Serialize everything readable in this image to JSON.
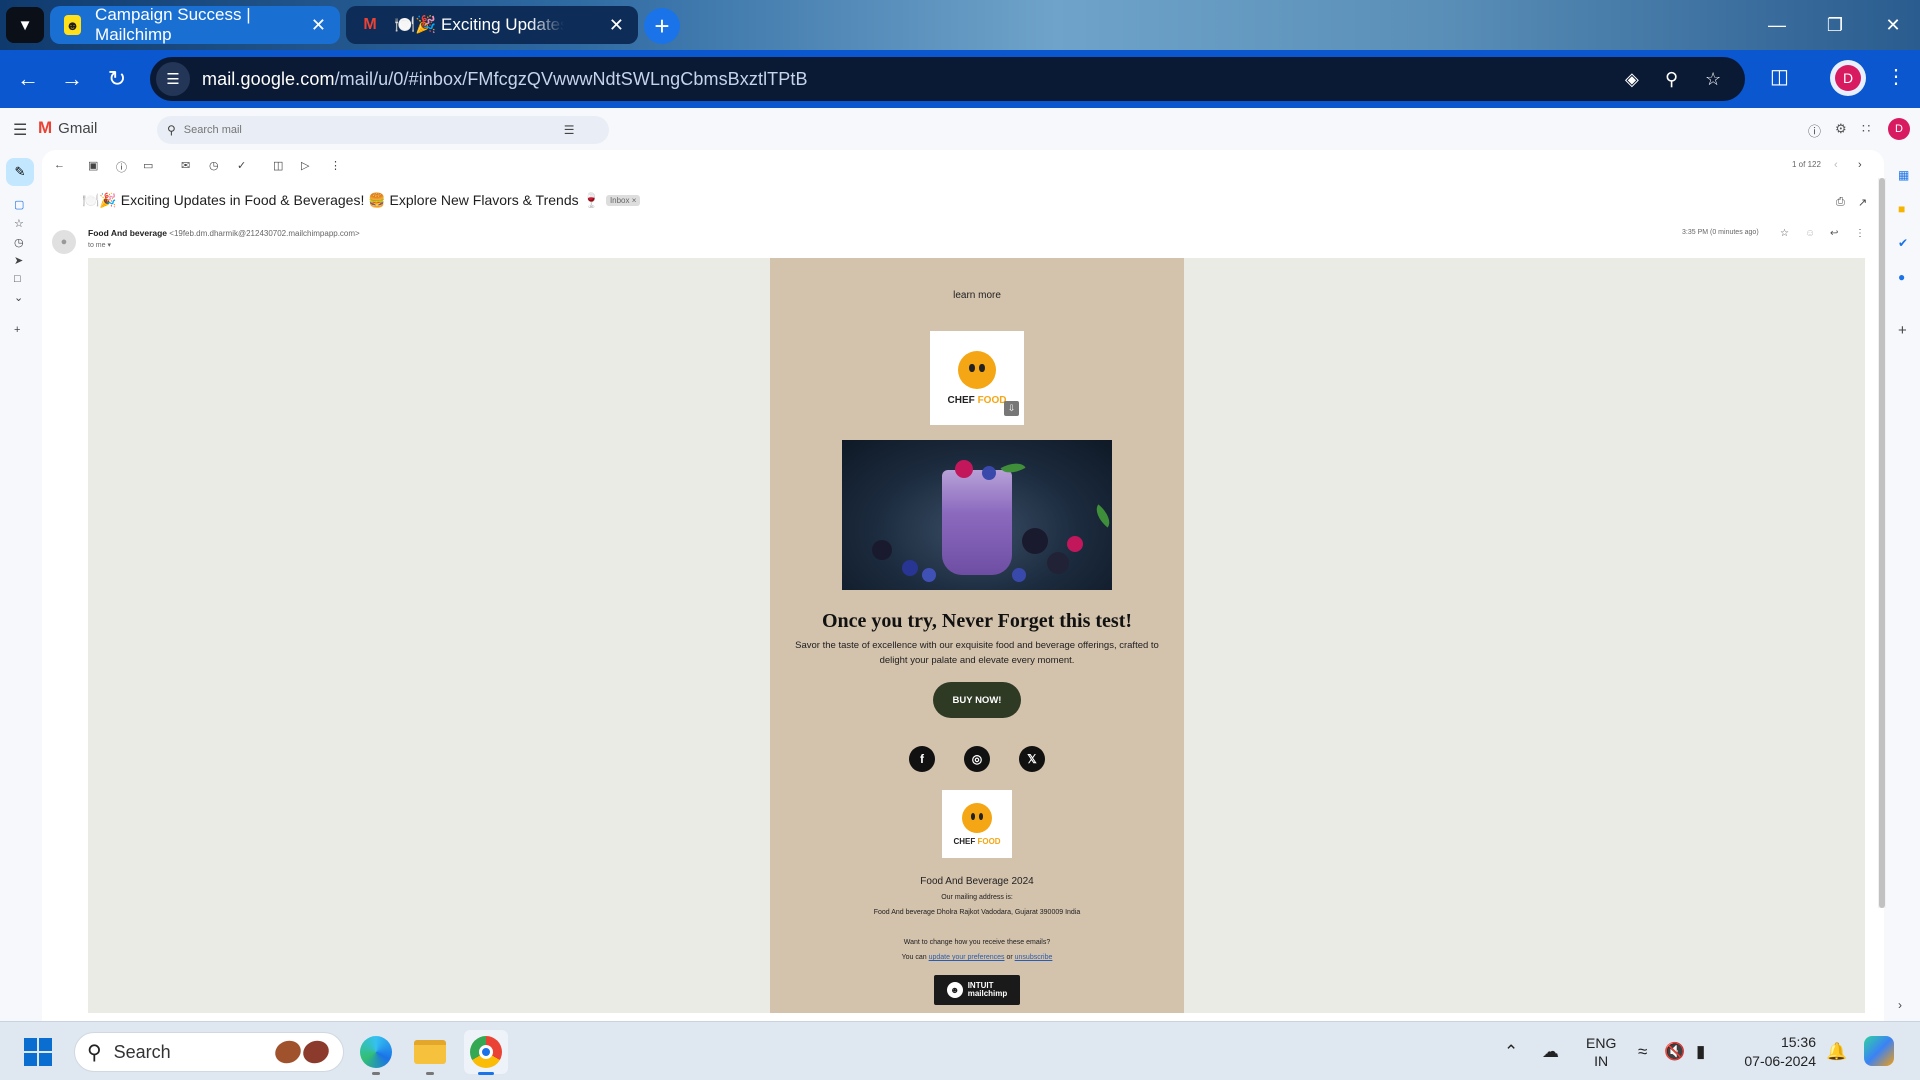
{
  "browser": {
    "tabs": [
      {
        "title": "Campaign Success | Mailchimp",
        "icon": "mailchimp-icon"
      },
      {
        "title": "🍽️🎉 Exciting Updates in Food",
        "icon": "gmail-icon"
      }
    ],
    "url_host": "mail.google.com",
    "url_path": "/mail/u/0/#inbox/FMfcgzQVwwwNdtSWLngCbmsBxztlTPtB",
    "profile_initial": "D",
    "accent": "#0b57d0"
  },
  "gmail": {
    "brand": "Gmail",
    "search_placeholder": "Search mail",
    "avatar_initial": "D",
    "pager": "1 of 122",
    "subject": "🍽️🎉 Exciting Updates in Food & Beverages! 🍔 Explore New Flavors & Trends 🍷",
    "label_chip": "Inbox ×",
    "sender_name": "Food And beverage",
    "sender_addr": "<19feb.dm.dharmik@212430702.mailchimpapp.com>",
    "to_me": "to me ▾",
    "time": "3:35 PM (0 minutes ago)"
  },
  "email": {
    "learn_more": "learn more",
    "logo_text_a": "CHEF",
    "logo_text_b": "FOOD",
    "headline": "Once you try, Never Forget this test!",
    "description": "Savor the taste of excellence with our exquisite food and beverage offerings, crafted to delight your palate and elevate every moment.",
    "cta": "BUY NOW!",
    "social": [
      "f",
      "◎",
      "𝕏"
    ],
    "footer_name": "Food And Beverage 2024",
    "mailing_label": "Our mailing address is:",
    "address": "Food And beverage Dholra Rajkot Vadodara, Gujarat 390009 India",
    "change_q": "Want to change how you receive these emails?",
    "you_can": "You can",
    "update_prefs": "update your preferences",
    "or": "or",
    "unsubscribe": "unsubscribe",
    "badge_l1": "INTUIT",
    "badge_l2": "mailchimp",
    "card_color": "#d3c2ac",
    "cta_color": "#2f3a24"
  },
  "taskbar": {
    "search_label": "Search",
    "lang_l1": "ENG",
    "lang_l2": "IN",
    "time": "15:36",
    "date": "07-06-2024"
  }
}
